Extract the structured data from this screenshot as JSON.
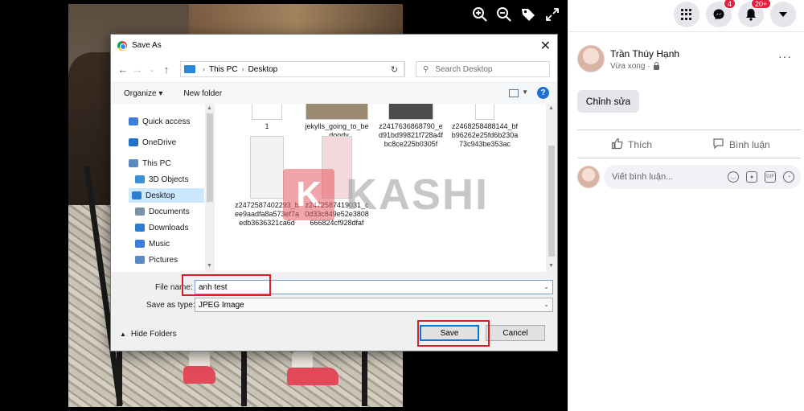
{
  "viewer": {
    "icons": [
      "zoom-in-icon",
      "zoom-out-icon",
      "tag-icon",
      "fullscreen-icon"
    ]
  },
  "dialog": {
    "title": "Save As",
    "close_glyph": "✕",
    "breadcrumb": [
      "This PC",
      "Desktop"
    ],
    "search_placeholder": "Search Desktop",
    "toolbar": {
      "organize": "Organize ▾",
      "new_folder": "New folder",
      "help": "?"
    },
    "nav_items": [
      {
        "label": "Quick access",
        "icon": "star-icon",
        "color": "#3b7dd8"
      },
      {
        "label": "OneDrive",
        "icon": "cloud-icon",
        "color": "#1e73c9"
      },
      {
        "label": "This PC",
        "icon": "computer-icon",
        "color": "#5a8ac4"
      },
      {
        "label": "3D Objects",
        "icon": "cube-icon",
        "color": "#3a8fd6"
      },
      {
        "label": "Desktop",
        "icon": "desktop-icon",
        "color": "#2a7fd3"
      },
      {
        "label": "Documents",
        "icon": "document-icon",
        "color": "#7a8fa8"
      },
      {
        "label": "Downloads",
        "icon": "download-icon",
        "color": "#2b7bd0"
      },
      {
        "label": "Music",
        "icon": "music-icon",
        "color": "#3b7dd8"
      },
      {
        "label": "Pictures",
        "icon": "pictures-icon",
        "color": "#5a8ac4"
      }
    ],
    "files": [
      {
        "name": "1"
      },
      {
        "name": "jekylls_going_to_be_doody"
      },
      {
        "name": "z2417636868790_ed91bd99821f728a4fbc8ce225b0305f"
      },
      {
        "name": "z2468258488144_bfb96262e25fd6b230a73c943be353ac"
      },
      {
        "name": "z2472587402293_bee9aadfa8a573ef7aedb3636321ca6d"
      },
      {
        "name": "z2472587419031_c0d33c849e52e3808666824cf928dfaf"
      }
    ],
    "file_name_label": "File name:",
    "file_name_value": "anh test",
    "save_type_label": "Save as type:",
    "save_type_value": "JPEG Image",
    "hide_folders": "Hide Folders",
    "save_button": "Save",
    "cancel_button": "Cancel",
    "highlight_color": "#d52027"
  },
  "watermark": {
    "letter": "K",
    "text": "KASHI"
  },
  "facebook": {
    "messenger_badge": "4",
    "notification_badge": "20+",
    "author_name": "Trần Thúy Hạnh",
    "post_status": "Vừa xong ·",
    "more_glyph": "···",
    "edit_button": "Chỉnh sửa",
    "like_label": "Thích",
    "comment_label": "Bình luận",
    "comment_placeholder": "Viết bình luận...",
    "accent_badge_color": "#e41e3f"
  }
}
